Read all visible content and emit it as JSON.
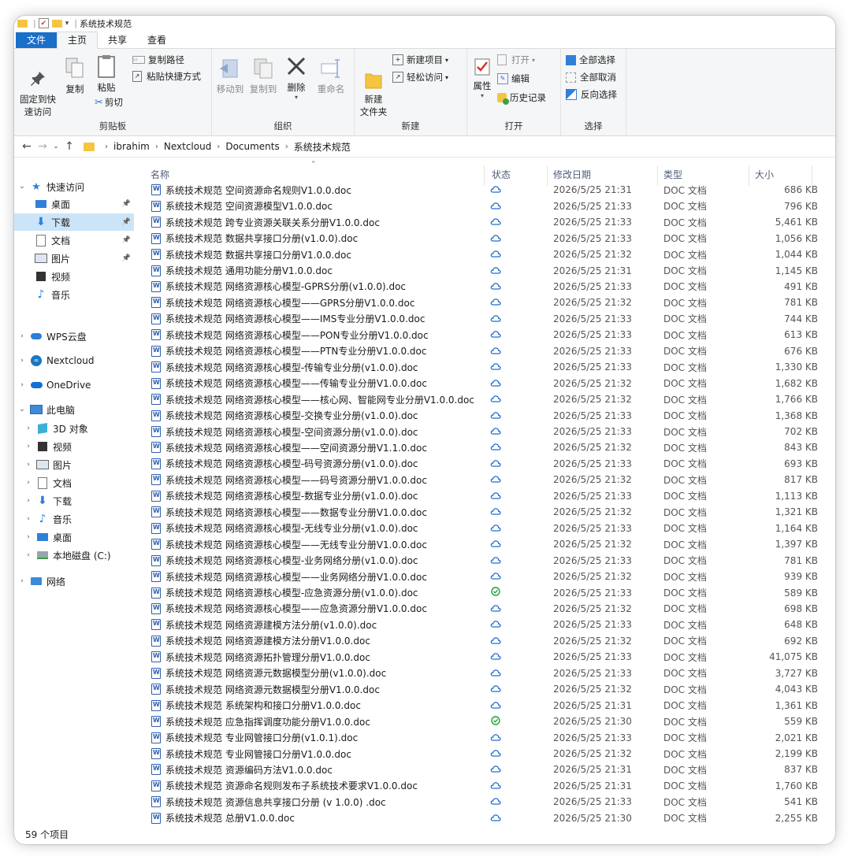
{
  "window_title": "系统技术规范",
  "tabs": [
    "文件",
    "主页",
    "共享",
    "查看"
  ],
  "ribbon": {
    "clipboard": {
      "label": "剪贴板",
      "pin": "固定到快\n速访问",
      "copy": "复制",
      "paste": "粘贴",
      "copy_path": "复制路径",
      "paste_shortcut": "粘贴快捷方式",
      "cut": "剪切"
    },
    "organize": {
      "label": "组织",
      "move_to": "移动到",
      "copy_to": "复制到",
      "delete": "删除",
      "rename": "重命名"
    },
    "new": {
      "label": "新建",
      "new_folder": "新建\n文件夹",
      "new_item": "新建项目",
      "easy_access": "轻松访问"
    },
    "open": {
      "label": "打开",
      "properties": "属性",
      "open": "打开",
      "edit": "编辑",
      "history": "历史记录"
    },
    "select": {
      "label": "选择",
      "select_all": "全部选择",
      "select_none": "全部取消",
      "invert": "反向选择"
    }
  },
  "breadcrumb": [
    "ibrahim",
    "Nextcloud",
    "Documents",
    "系统技术规范"
  ],
  "nav": {
    "quick_access": "快速访问",
    "qa_items": [
      {
        "label": "桌面",
        "pinned": true,
        "icon": "desktop-icon"
      },
      {
        "label": "下载",
        "pinned": true,
        "icon": "download-icon",
        "selected": true
      },
      {
        "label": "文档",
        "pinned": true,
        "icon": "document-icon"
      },
      {
        "label": "图片",
        "pinned": true,
        "icon": "picture-icon"
      },
      {
        "label": "视频",
        "pinned": false,
        "icon": "video-icon"
      },
      {
        "label": "音乐",
        "pinned": false,
        "icon": "music-icon"
      }
    ],
    "wps": "WPS云盘",
    "nextcloud": "Nextcloud",
    "onedrive": "OneDrive",
    "this_pc": "此电脑",
    "pc_items": [
      {
        "label": "3D 对象",
        "icon": "3d-objects-icon"
      },
      {
        "label": "视频",
        "icon": "video-icon"
      },
      {
        "label": "图片",
        "icon": "picture-icon"
      },
      {
        "label": "文档",
        "icon": "document-icon"
      },
      {
        "label": "下载",
        "icon": "download-icon"
      },
      {
        "label": "音乐",
        "icon": "music-icon"
      },
      {
        "label": "桌面",
        "icon": "desktop-icon"
      },
      {
        "label": "本地磁盘 (C:)",
        "icon": "drive-icon"
      }
    ],
    "network": "网络"
  },
  "columns": {
    "name": "名称",
    "status": "状态",
    "date": "修改日期",
    "type": "类型",
    "size": "大小"
  },
  "files": [
    {
      "name": "系统技术规范 空间资源命名规则V1.0.0.doc",
      "status": "cloud",
      "date": "2026/5/25 21:31",
      "type": "DOC 文档",
      "size": "686 KB"
    },
    {
      "name": "系统技术规范 空间资源模型V1.0.0.doc",
      "status": "cloud",
      "date": "2026/5/25 21:33",
      "type": "DOC 文档",
      "size": "796 KB"
    },
    {
      "name": "系统技术规范 跨专业资源关联关系分册V1.0.0.doc",
      "status": "cloud",
      "date": "2026/5/25 21:33",
      "type": "DOC 文档",
      "size": "5,461 KB"
    },
    {
      "name": "系统技术规范 数据共享接口分册(v1.0.0).doc",
      "status": "cloud",
      "date": "2026/5/25 21:33",
      "type": "DOC 文档",
      "size": "1,056 KB"
    },
    {
      "name": "系统技术规范 数据共享接口分册V1.0.0.doc",
      "status": "cloud",
      "date": "2026/5/25 21:32",
      "type": "DOC 文档",
      "size": "1,044 KB"
    },
    {
      "name": "系统技术规范 通用功能分册V1.0.0.doc",
      "status": "cloud",
      "date": "2026/5/25 21:31",
      "type": "DOC 文档",
      "size": "1,145 KB"
    },
    {
      "name": "系统技术规范 网络资源核心模型-GPRS分册(v1.0.0).doc",
      "status": "cloud",
      "date": "2026/5/25 21:33",
      "type": "DOC 文档",
      "size": "491 KB"
    },
    {
      "name": "系统技术规范 网络资源核心模型——GPRS分册V1.0.0.doc",
      "status": "cloud",
      "date": "2026/5/25 21:32",
      "type": "DOC 文档",
      "size": "781 KB"
    },
    {
      "name": "系统技术规范 网络资源核心模型——IMS专业分册V1.0.0.doc",
      "status": "cloud",
      "date": "2026/5/25 21:33",
      "type": "DOC 文档",
      "size": "744 KB"
    },
    {
      "name": "系统技术规范 网络资源核心模型——PON专业分册V1.0.0.doc",
      "status": "cloud",
      "date": "2026/5/25 21:33",
      "type": "DOC 文档",
      "size": "613 KB"
    },
    {
      "name": "系统技术规范 网络资源核心模型——PTN专业分册V1.0.0.doc",
      "status": "cloud",
      "date": "2026/5/25 21:33",
      "type": "DOC 文档",
      "size": "676 KB"
    },
    {
      "name": "系统技术规范 网络资源核心模型-传输专业分册(v1.0.0).doc",
      "status": "cloud",
      "date": "2026/5/25 21:33",
      "type": "DOC 文档",
      "size": "1,330 KB"
    },
    {
      "name": "系统技术规范 网络资源核心模型——传输专业分册V1.0.0.doc",
      "status": "cloud",
      "date": "2026/5/25 21:32",
      "type": "DOC 文档",
      "size": "1,682 KB"
    },
    {
      "name": "系统技术规范 网络资源核心模型——核心网、智能网专业分册V1.0.0.doc",
      "status": "cloud",
      "date": "2026/5/25 21:32",
      "type": "DOC 文档",
      "size": "1,766 KB"
    },
    {
      "name": "系统技术规范 网络资源核心模型-交换专业分册(v1.0.0).doc",
      "status": "cloud",
      "date": "2026/5/25 21:33",
      "type": "DOC 文档",
      "size": "1,368 KB"
    },
    {
      "name": "系统技术规范 网络资源核心模型-空间资源分册(v1.0.0).doc",
      "status": "cloud",
      "date": "2026/5/25 21:33",
      "type": "DOC 文档",
      "size": "702 KB"
    },
    {
      "name": "系统技术规范 网络资源核心模型——空间资源分册V1.1.0.doc",
      "status": "cloud",
      "date": "2026/5/25 21:32",
      "type": "DOC 文档",
      "size": "843 KB"
    },
    {
      "name": "系统技术规范 网络资源核心模型-码号资源分册(v1.0.0).doc",
      "status": "cloud",
      "date": "2026/5/25 21:33",
      "type": "DOC 文档",
      "size": "693 KB"
    },
    {
      "name": "系统技术规范 网络资源核心模型——码号资源分册V1.0.0.doc",
      "status": "cloud",
      "date": "2026/5/25 21:32",
      "type": "DOC 文档",
      "size": "817 KB"
    },
    {
      "name": "系统技术规范 网络资源核心模型-数据专业分册(v1.0.0).doc",
      "status": "cloud",
      "date": "2026/5/25 21:33",
      "type": "DOC 文档",
      "size": "1,113 KB"
    },
    {
      "name": "系统技术规范 网络资源核心模型——数据专业分册V1.0.0.doc",
      "status": "cloud",
      "date": "2026/5/25 21:32",
      "type": "DOC 文档",
      "size": "1,321 KB"
    },
    {
      "name": "系统技术规范 网络资源核心模型-无线专业分册(v1.0.0).doc",
      "status": "cloud",
      "date": "2026/5/25 21:33",
      "type": "DOC 文档",
      "size": "1,164 KB"
    },
    {
      "name": "系统技术规范 网络资源核心模型——无线专业分册V1.0.0.doc",
      "status": "cloud",
      "date": "2026/5/25 21:32",
      "type": "DOC 文档",
      "size": "1,397 KB"
    },
    {
      "name": "系统技术规范 网络资源核心模型-业务网络分册(v1.0.0).doc",
      "status": "cloud",
      "date": "2026/5/25 21:33",
      "type": "DOC 文档",
      "size": "781 KB"
    },
    {
      "name": "系统技术规范 网络资源核心模型——业务网络分册V1.0.0.doc",
      "status": "cloud",
      "date": "2026/5/25 21:32",
      "type": "DOC 文档",
      "size": "939 KB"
    },
    {
      "name": "系统技术规范 网络资源核心模型-应急资源分册(v1.0.0).doc",
      "status": "synced",
      "date": "2026/5/25 21:33",
      "type": "DOC 文档",
      "size": "589 KB"
    },
    {
      "name": "系统技术规范 网络资源核心模型——应急资源分册V1.0.0.doc",
      "status": "cloud",
      "date": "2026/5/25 21:32",
      "type": "DOC 文档",
      "size": "698 KB"
    },
    {
      "name": "系统技术规范 网络资源建模方法分册(v1.0.0).doc",
      "status": "cloud",
      "date": "2026/5/25 21:33",
      "type": "DOC 文档",
      "size": "648 KB"
    },
    {
      "name": "系统技术规范 网络资源建模方法分册V1.0.0.doc",
      "status": "cloud",
      "date": "2026/5/25 21:32",
      "type": "DOC 文档",
      "size": "692 KB"
    },
    {
      "name": "系统技术规范 网络资源拓扑管理分册V1.0.0.doc",
      "status": "cloud",
      "date": "2026/5/25 21:33",
      "type": "DOC 文档",
      "size": "41,075 KB"
    },
    {
      "name": "系统技术规范 网络资源元数据模型分册(v1.0.0).doc",
      "status": "cloud",
      "date": "2026/5/25 21:33",
      "type": "DOC 文档",
      "size": "3,727 KB"
    },
    {
      "name": "系统技术规范 网络资源元数据模型分册V1.0.0.doc",
      "status": "cloud",
      "date": "2026/5/25 21:32",
      "type": "DOC 文档",
      "size": "4,043 KB"
    },
    {
      "name": "系统技术规范 系统架构和接口分册V1.0.0.doc",
      "status": "cloud",
      "date": "2026/5/25 21:31",
      "type": "DOC 文档",
      "size": "1,361 KB"
    },
    {
      "name": "系统技术规范 应急指挥调度功能分册V1.0.0.doc",
      "status": "synced",
      "date": "2026/5/25 21:30",
      "type": "DOC 文档",
      "size": "559 KB"
    },
    {
      "name": "系统技术规范 专业网管接口分册(v1.0.1).doc",
      "status": "cloud",
      "date": "2026/5/25 21:33",
      "type": "DOC 文档",
      "size": "2,021 KB"
    },
    {
      "name": "系统技术规范 专业网管接口分册V1.0.0.doc",
      "status": "cloud",
      "date": "2026/5/25 21:32",
      "type": "DOC 文档",
      "size": "2,199 KB"
    },
    {
      "name": "系统技术规范 资源编码方法V1.0.0.doc",
      "status": "cloud",
      "date": "2026/5/25 21:31",
      "type": "DOC 文档",
      "size": "837 KB"
    },
    {
      "name": "系统技术规范 资源命名规则发布子系统技术要求V1.0.0.doc",
      "status": "cloud",
      "date": "2026/5/25 21:31",
      "type": "DOC 文档",
      "size": "1,760 KB"
    },
    {
      "name": "系统技术规范 资源信息共享接口分册 (v 1.0.0) .doc",
      "status": "cloud",
      "date": "2026/5/25 21:33",
      "type": "DOC 文档",
      "size": "541 KB"
    },
    {
      "name": "系统技术规范 总册V1.0.0.doc",
      "status": "cloud",
      "date": "2026/5/25 21:30",
      "type": "DOC 文档",
      "size": "2,255 KB"
    }
  ],
  "status_bar": "59 个项目",
  "colors": {
    "accent": "#1a6fc9",
    "selected": "#cce4f7",
    "cloud": "#1f6fd1",
    "synced": "#1f9e3a",
    "folder": "#f5c542"
  }
}
